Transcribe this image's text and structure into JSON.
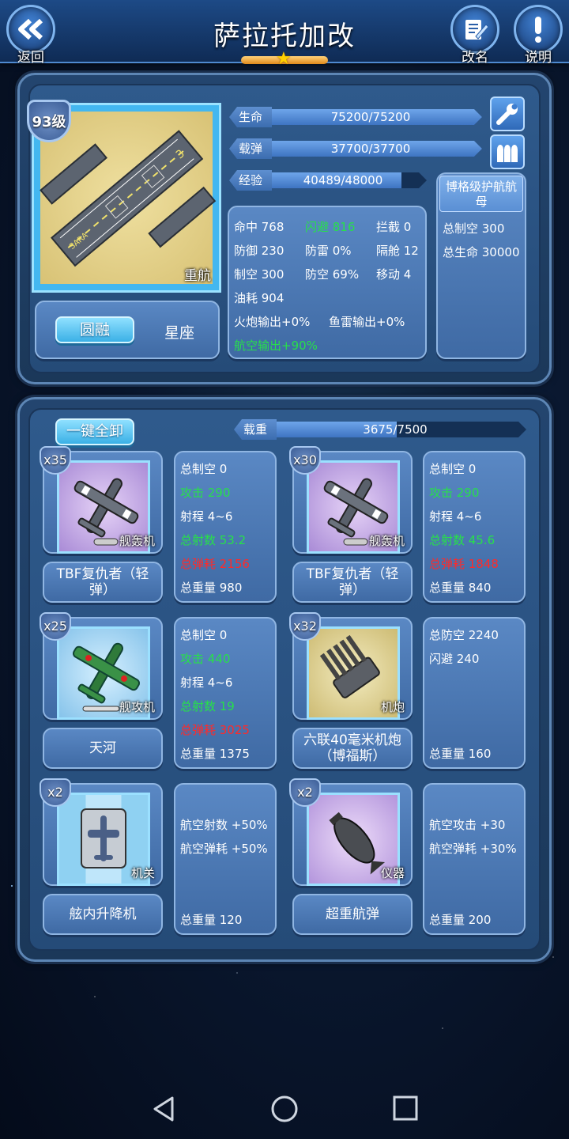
{
  "header": {
    "title": "萨拉托加改",
    "back_label": "返回",
    "rename_label": "改名",
    "help_label": "说明",
    "star_count": 1
  },
  "ship": {
    "level": "93级",
    "portrait_tag": "重航",
    "portrait_text": "SARA",
    "hp_label": "生命",
    "hp_value": "75200/75200",
    "hp_fraction": 1.0,
    "ammo_label": "载弹",
    "ammo_value": "37700/37700",
    "ammo_fraction": 1.0,
    "exp_label": "经验",
    "exp_value": "40489/48000",
    "exp_fraction": 0.843,
    "mode_active": "圆融",
    "mode_other": "星座",
    "stats": {
      "hit": "命中 768",
      "evade": "闪避 816",
      "intercept": "拦截 0",
      "defense": "防御 230",
      "torpedo_def": "防雷 0%",
      "armor": "隔舱 12",
      "air_control": "制空 300",
      "aa": "防空 69%",
      "move": "移动 4",
      "fuel": "油耗 904",
      "gun_out": "火炮输出+0%",
      "torp_out": "鱼雷输出+0%",
      "air_out": "航空输出+90%"
    },
    "class_bonus": {
      "title": "博格级护航航母",
      "line1": "总制空 300",
      "line2": "总生命 30000"
    }
  },
  "loadout": {
    "unequip_all": "一键全卸",
    "load_label": "载重",
    "load_value": "3675/7500",
    "load_fraction": 0.49,
    "items": [
      {
        "count": "x35",
        "tag": "舰轰机",
        "name": "TBF复仇者（轻弹）",
        "stats": [
          "总制空 0",
          "攻击 290",
          "射程 4~6",
          "总射数 53.2",
          "总弹耗 2156",
          "总重量 980"
        ]
      },
      {
        "count": "x30",
        "tag": "舰轰机",
        "name": "TBF复仇者（轻弹）",
        "stats": [
          "总制空 0",
          "攻击 290",
          "射程 4~6",
          "总射数 45.6",
          "总弹耗 1848",
          "总重量 840"
        ]
      },
      {
        "count": "x25",
        "tag": "舰攻机",
        "name": "天河",
        "stats": [
          "总制空 0",
          "攻击 440",
          "射程 4~6",
          "总射数 19",
          "总弹耗 3025",
          "总重量 1375"
        ]
      },
      {
        "count": "x32",
        "tag": "机炮",
        "name": "六联40毫米机炮（博福斯）",
        "stats": [
          "总防空 2240",
          "闪避 240",
          "",
          "",
          "",
          "总重量 160"
        ]
      },
      {
        "count": "x2",
        "tag": "机关",
        "name": "舷内升降机",
        "stats": [
          "",
          "航空射数 +50%",
          "航空弹耗 +50%",
          "",
          "",
          "总重量 120"
        ]
      },
      {
        "count": "x2",
        "tag": "仪器",
        "name": "超重航弹",
        "stats": [
          "",
          "航空攻击 +30",
          "航空弹耗 +30%",
          "",
          "",
          "总重量 200"
        ]
      }
    ]
  },
  "colors": {
    "positive": "#27e04a",
    "negative": "#ff2a2a",
    "accent": "#43b7f0"
  }
}
